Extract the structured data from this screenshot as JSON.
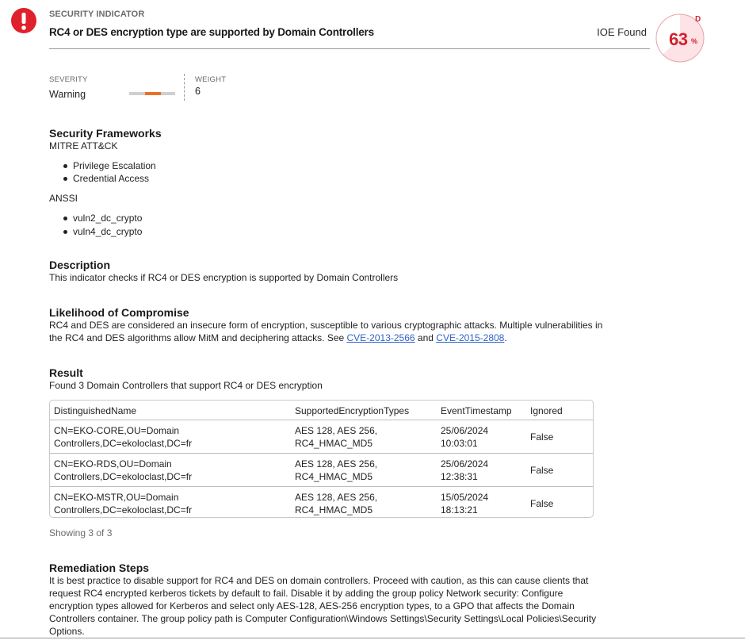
{
  "header": {
    "kicker": "SECURITY INDICATOR",
    "title": "RC4 or DES encryption type are supported by Domain Controllers",
    "status": "IOE Found",
    "icon": "exclamation-icon",
    "accent_color": "#e0202b"
  },
  "score": {
    "grade": "D",
    "value": "63",
    "unit": "%",
    "percent": 63
  },
  "meta": {
    "severity_label": "SEVERITY",
    "severity_value": "Warning",
    "severity_level": 0.5,
    "severity_color": "#e8712a",
    "weight_label": "WEIGHT",
    "weight_value": "6"
  },
  "frameworks": {
    "heading": "Security Frameworks",
    "groups": [
      {
        "name": "MITRE ATT&CK",
        "items": [
          "Privilege Escalation",
          "Credential Access"
        ]
      },
      {
        "name": "ANSSI",
        "items": [
          "vuln2_dc_crypto",
          "vuln4_dc_crypto"
        ]
      }
    ]
  },
  "description": {
    "heading": "Description",
    "text": "This indicator checks if RC4 or DES encryption is supported by Domain Controllers"
  },
  "likelihood": {
    "heading": "Likelihood of Compromise",
    "line1": "RC4 and DES are considered an insecure form of encryption, susceptible to various cryptographic attacks. Multiple vulnerabilities in",
    "line2_pre": "the RC4 and DES algorithms allow MitM and deciphering attacks. See ",
    "link1": "CVE-2013-2566",
    "mid": " and ",
    "link2": "CVE-2015-2808",
    "end": "."
  },
  "result": {
    "heading": "Result",
    "summary": "Found 3 Domain Controllers that support RC4 or DES encryption",
    "columns": [
      "DistinguishedName",
      "SupportedEncryptionTypes",
      "EventTimestamp",
      "Ignored"
    ],
    "rows": [
      {
        "dn1": "CN=EKO-CORE,OU=Domain",
        "dn2": "Controllers,DC=ekoloclast,DC=fr",
        "enc1": "AES 128, AES 256,",
        "enc2": "RC4_HMAC_MD5",
        "date": "25/06/2024",
        "time": "10:03:01",
        "ignored": "False"
      },
      {
        "dn1": "CN=EKO-RDS,OU=Domain",
        "dn2": "Controllers,DC=ekoloclast,DC=fr",
        "enc1": "AES 128, AES 256,",
        "enc2": "RC4_HMAC_MD5",
        "date": "25/06/2024",
        "time": "12:38:31",
        "ignored": "False"
      },
      {
        "dn1": "CN=EKO-MSTR,OU=Domain",
        "dn2": "Controllers,DC=ekoloclast,DC=fr",
        "enc1": "AES 128, AES 256,",
        "enc2": "RC4_HMAC_MD5",
        "date": "15/05/2024",
        "time": "18:13:21",
        "ignored": "False"
      }
    ],
    "showing": "Showing 3 of 3"
  },
  "remediation": {
    "heading": "Remediation Steps",
    "lines": [
      "It is best practice to disable support for RC4 and DES on domain controllers. Proceed with caution, as this can cause clients that",
      "request RC4 encrypted kerberos tickets by default to fail. Disable it by adding the group policy Network security: Configure",
      "encryption types allowed for Kerberos and select only AES-128, AES-256 encryption types, to a GPO that affects the Domain",
      "Controllers container. The group policy path is Computer Configuration\\Windows Settings\\Security Settings\\Local Policies\\Security",
      "Options."
    ]
  }
}
